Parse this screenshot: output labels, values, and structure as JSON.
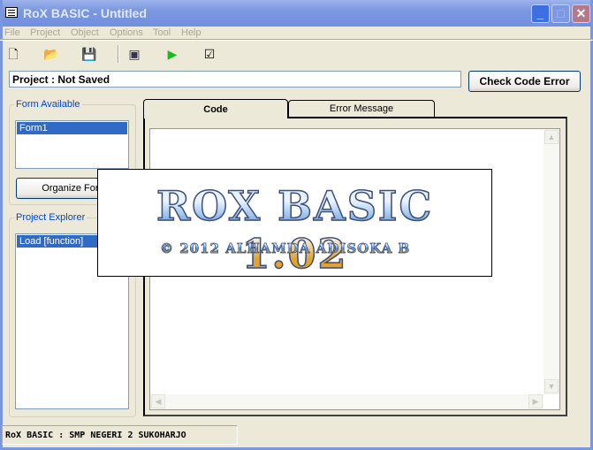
{
  "window": {
    "title": "RoX BASIC - Untitled",
    "controls": {
      "minimize": "_",
      "maximize": "□",
      "close": "✕"
    }
  },
  "menu": [
    "File",
    "Project",
    "Object",
    "Options",
    "Tool",
    "Help"
  ],
  "toolbar": [
    {
      "icon": "new-file-icon",
      "glyph": "🗋"
    },
    {
      "icon": "open-folder-icon",
      "glyph": "📂"
    },
    {
      "icon": "save-icon",
      "glyph": "💾"
    },
    {
      "icon": "compile-icon",
      "glyph": "▣"
    },
    {
      "icon": "run-icon",
      "glyph": "▶"
    },
    {
      "icon": "check-icon",
      "glyph": "☑"
    }
  ],
  "project_field": "Project : Not Saved",
  "check_button": "Check Code Error",
  "form_group": {
    "label": "Form Available",
    "items": [
      "Form1"
    ],
    "button": "Organize Form"
  },
  "explorer_group": {
    "label": "Project Explorer",
    "items": [
      "Load [function]"
    ]
  },
  "tabs": [
    "Code",
    "Error Message"
  ],
  "splash": {
    "title": "ROX BASIC 1.02",
    "subtitle": "© 2012 ALHAMDA ADISOKA B"
  },
  "statusbar": "RoX BASIC : SMP NEGERI 2 SUKOHARJO"
}
